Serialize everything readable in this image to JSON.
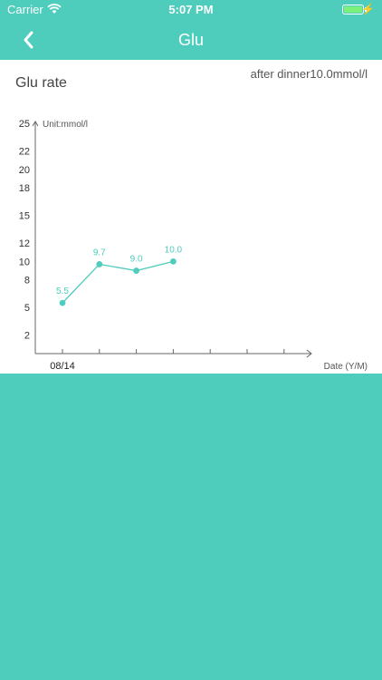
{
  "status": {
    "carrier": "Carrier",
    "time": "5:07 PM",
    "icons": [
      "wifi-icon",
      "battery-icon",
      "charging-icon"
    ]
  },
  "nav": {
    "title": "Glu",
    "back_icon": "chevron-left-icon"
  },
  "card": {
    "title": "Glu rate",
    "info": "after dinner10.0mmol/l"
  },
  "colors": {
    "accent": "#4ecdbd",
    "line": "#4ecdbd",
    "axis": "#666666"
  },
  "chart_data": {
    "type": "line",
    "ylabel": "Unit:mmol/l",
    "xlabel": "Date (Y/M)",
    "yticks": [
      2,
      5,
      8,
      10,
      12,
      15,
      18,
      20,
      22,
      25
    ],
    "ylim": [
      0,
      25
    ],
    "categories": [
      "08/14",
      "",
      "",
      ""
    ],
    "series": [
      {
        "values": [
          5.5,
          9.7,
          9.0,
          10.0
        ]
      }
    ],
    "x_slot_count": 7,
    "grid": false
  }
}
